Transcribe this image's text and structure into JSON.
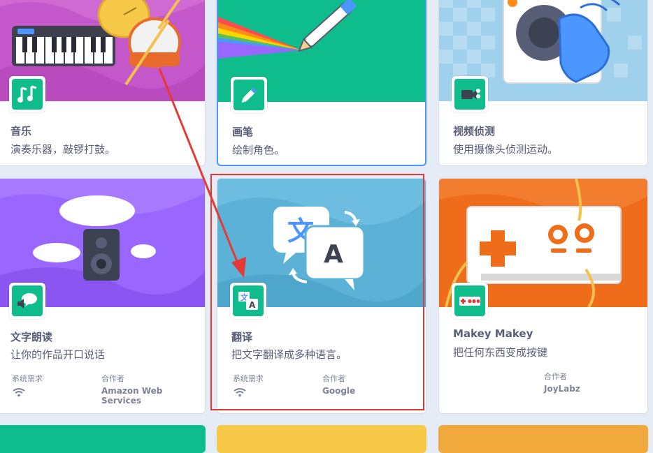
{
  "cards": [
    {
      "title": "音乐",
      "description": "演奏乐器，敲锣打鼓。",
      "icon": "music-notes-icon",
      "color": "#0fbd8c"
    },
    {
      "title": "画笔",
      "description": "绘制角色。",
      "icon": "pen-icon",
      "color": "#0fbd8c"
    },
    {
      "title": "视频侦测",
      "description": "使用摄像头侦测运动。",
      "icon": "video-camera-icon",
      "color": "#0fbd8c"
    },
    {
      "title": "文字朗读",
      "description": "让你的作品开口说话",
      "icon": "speech-bubble-icon",
      "color": "#0fbd8c",
      "requirements_label": "系统需求",
      "collaborator_label": "合作者",
      "collaborator": "Amazon Web Services"
    },
    {
      "title": "翻译",
      "description": "把文字翻译成多种语言。",
      "icon": "translate-icon",
      "color": "#0fbd8c",
      "requirements_label": "系统需求",
      "collaborator_label": "合作者",
      "collaborator": "Google"
    },
    {
      "title": "Makey Makey",
      "description": "把任何东西变成按键",
      "icon": "makey-board-icon",
      "color": "#0fbd8c",
      "collaborator_label": "合作者",
      "collaborator": "JoyLabz"
    }
  ],
  "colors": {
    "accent_selected": "#4c97ff",
    "highlight_annotation": "#e53935",
    "extension_green": "#0fbd8c"
  }
}
